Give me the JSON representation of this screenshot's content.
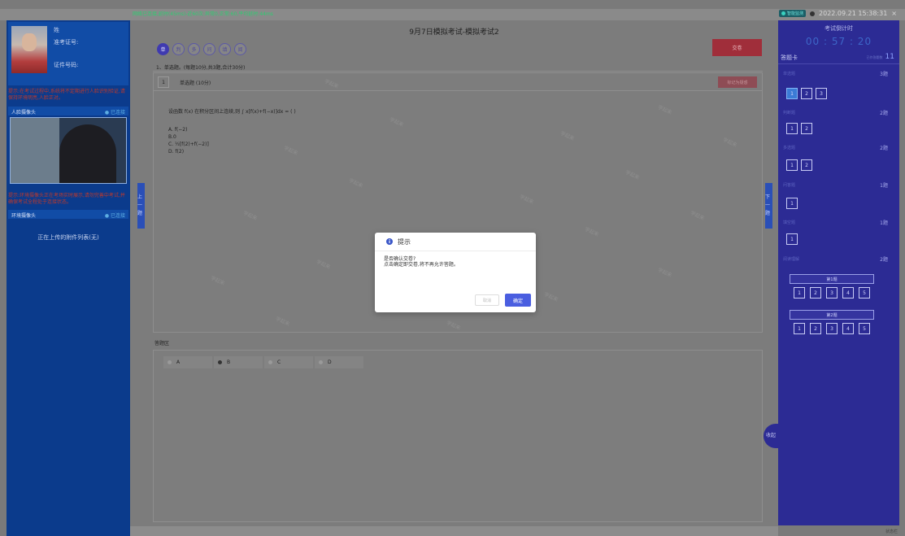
{
  "topbar": {
    "net_status": "网络已连接,延时(45ms)-近60次:异常0,正常:60,平均延时:44ms",
    "net_badge": "智能监测",
    "datetime": "2022.09.21 15:38:31",
    "close": "×"
  },
  "left": {
    "name_label": "姓",
    "ticket_label": "准考证号:",
    "id_label": "证件号码:",
    "tip1": "提示:在考试过程中,系统将不定期进行人脸识别验证,请保持环境明亮,人脸正对。",
    "face_cam_title": "人脸摄像头",
    "face_cam_status": "● 已连接",
    "tip2": "提示:环境摄像头正在考场实时展示,请勿完善中考试,并确保考试全程处于连接状态。",
    "env_cam_title": "环境摄像头",
    "env_cam_status": "● 已连接",
    "upload_text": "正在上传的附件列表(无)"
  },
  "center": {
    "exam_title": "9月7日模拟考试-模拟考试2",
    "tabs": [
      "单",
      "判",
      "多",
      "问",
      "填",
      "阅"
    ],
    "submit_label": "交卷",
    "section_line": "1、单选题。(每题10分,共3题,合计30分)",
    "question_num": "1",
    "question_type": "单选题 (10分)",
    "mark_label": "标记为疑惑",
    "question_text": "设函数 f(x) 在积分区间上连续,则 ∫ x[f(x)+f(−x)]dx = ( )",
    "options": [
      "A. f(−2)",
      "B.0",
      "C. ½[f(2)+f(−2)]",
      "D. f(2)"
    ],
    "prev_tab": "上一题",
    "next_tab": "下一题",
    "answer_area_label": "答题区",
    "answer_choices": [
      "A",
      "B",
      "C",
      "D"
    ],
    "selected_choice": "B",
    "watermark": "学起来"
  },
  "right": {
    "timer_label": "考试倒计时",
    "timer": "00 : 57 : 20",
    "sheet_title": "答题卡",
    "sheet_count_small": "已作答题数",
    "sheet_count": "11",
    "groups": [
      {
        "name": "单选题",
        "score": "3题",
        "questions": [
          "1",
          "2",
          "3"
        ]
      },
      {
        "name": "判断题",
        "score": "2题",
        "questions": [
          "1",
          "2"
        ]
      },
      {
        "name": "多选题",
        "score": "2题",
        "questions": [
          "1",
          "2"
        ]
      },
      {
        "name": "问答题",
        "score": "1题",
        "questions": [
          "1"
        ]
      },
      {
        "name": "填空题",
        "score": "1题",
        "questions": [
          "1"
        ]
      },
      {
        "name": "阅读理解",
        "score": "2题",
        "questions": []
      }
    ],
    "subgroups": [
      {
        "name": "第1题",
        "questions": [
          "1",
          "2",
          "3",
          "4",
          "5"
        ]
      },
      {
        "name": "第2题",
        "questions": [
          "1",
          "2",
          "3",
          "4",
          "5"
        ]
      }
    ],
    "float_btn": "收起",
    "status_text": "状态栏"
  },
  "modal": {
    "title": "提示",
    "body_line1": "是否确认交卷?",
    "body_line2": "点击确定即交卷,将不再允许答题。",
    "cancel_label": "取消",
    "ok_label": "确定"
  },
  "colors": {
    "left_panel": "#0b3b8c",
    "right_panel": "#2c2b94",
    "submit": "#a02e3a",
    "primary": "#4a5ee0"
  }
}
